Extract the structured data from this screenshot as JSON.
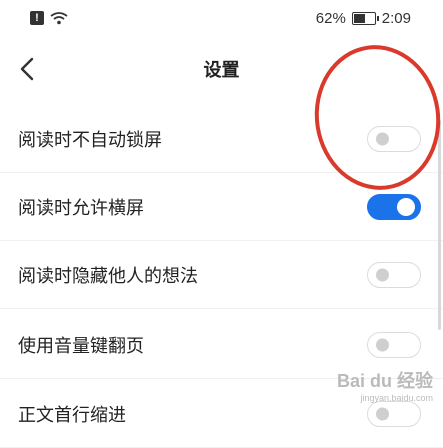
{
  "status_bar": {
    "battery_percent": "62%",
    "time": "2:09",
    "icons": [
      "alert-icon",
      "wifi-icon",
      "battery-icon"
    ]
  },
  "header": {
    "title": "设置",
    "back_icon": "chevron-left-icon"
  },
  "settings": [
    {
      "label": "阅读时不自动锁屏",
      "enabled": false
    },
    {
      "label": "阅读时允许横屏",
      "enabled": true
    },
    {
      "label": "阅读时隐藏他人的想法",
      "enabled": false
    },
    {
      "label": "使用音量键翻页",
      "enabled": false
    },
    {
      "label": "正文首行缩进",
      "enabled": false
    }
  ],
  "watermark": {
    "text": "Bai du 经验",
    "sub": "jingyan.baidu.com"
  },
  "colors": {
    "accent": "#1a73e8",
    "annotation": "#d93a2b",
    "toggle_off_border": "#dcdcdc"
  }
}
